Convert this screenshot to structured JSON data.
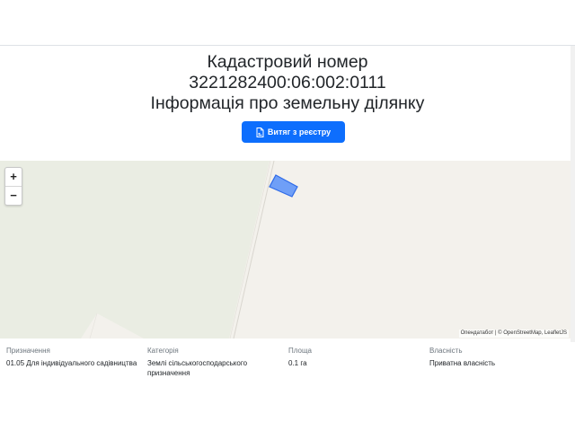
{
  "header": {
    "title_line1": "Кадастровий номер",
    "cadastral_number": "3221282400:06:002:0111",
    "title_line3": "Інформація про земельну ділянку"
  },
  "actions": {
    "extract_button_label": "Витяг з реєстру",
    "extract_button_icon": "document-icon"
  },
  "map": {
    "zoom_in_label": "+",
    "zoom_out_label": "−",
    "attribution_prefix": "Опендатабот",
    "attribution_separator": " | © ",
    "attribution_osm": "OpenStreetMap",
    "attribution_leaflet": "LeafletJS",
    "parcel_color": "#6f9ff7",
    "parcel_stroke": "#2f6be8"
  },
  "details": [
    {
      "label": "Призначення",
      "value": "01.05 Для індивідуального садівництва"
    },
    {
      "label": "Категорія",
      "value": "Землі сільськогосподарського призначення"
    },
    {
      "label": "Площа",
      "value": "0.1 га"
    },
    {
      "label": "Власність",
      "value": "Приватна власність"
    }
  ],
  "colors": {
    "primary": "#0d6efd",
    "map_land": "#eaede3",
    "map_area": "#f3f1ec"
  }
}
